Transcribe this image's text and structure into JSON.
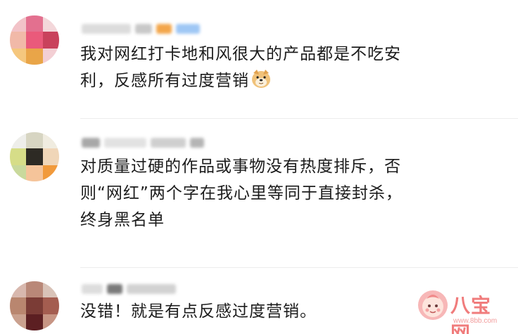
{
  "comments": [
    {
      "text_lines": [
        "我对网红打卡地和风很大的产品都是不吃安",
        "利，反感所有过度营销"
      ],
      "emoji": "doge-emoji"
    },
    {
      "text_lines": [
        "对质量过硬的作品或事物没有热度排斥，否",
        "则“网红”两个字在我心里等同于直接封杀，",
        "终身黑名单"
      ]
    },
    {
      "text_lines": [
        "没错！就是有点反感过度营销。"
      ]
    }
  ],
  "watermark": {
    "brand": "八宝网",
    "url": "www.8bb.com"
  },
  "colors": {
    "text": "#1c1c1c",
    "divider": "#ececec",
    "watermark": "#f07c7c"
  }
}
